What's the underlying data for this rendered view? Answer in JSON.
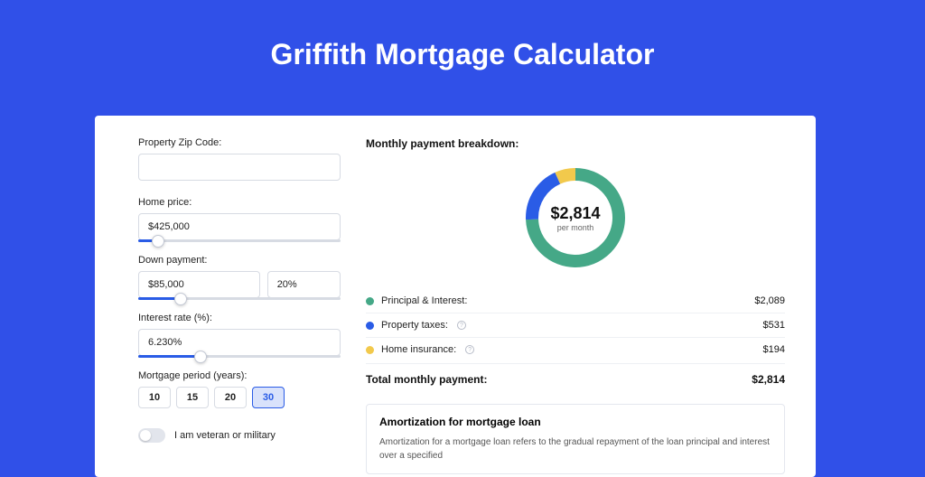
{
  "page": {
    "title": "Griffith Mortgage Calculator"
  },
  "form": {
    "zip": {
      "label": "Property Zip Code:",
      "value": ""
    },
    "home_price": {
      "label": "Home price:",
      "value": "$425,000",
      "slider_pct": 10
    },
    "down_payment": {
      "label": "Down payment:",
      "amount": "$85,000",
      "percent": "20%",
      "slider_pct": 21
    },
    "interest_rate": {
      "label": "Interest rate (%):",
      "value": "6.230%",
      "slider_pct": 31
    },
    "period": {
      "label": "Mortgage period (years):",
      "options": [
        "10",
        "15",
        "20",
        "30"
      ],
      "selected": "30"
    },
    "veteran": {
      "label": "I am veteran or military",
      "on": false
    }
  },
  "breakdown": {
    "title": "Monthly payment breakdown:",
    "center_amount": "$2,814",
    "center_sub": "per month",
    "items": [
      {
        "key": "principal_interest",
        "label": "Principal & Interest:",
        "value": "$2,089",
        "color": "#45a887",
        "info": false
      },
      {
        "key": "property_taxes",
        "label": "Property taxes:",
        "value": "$531",
        "color": "#2a5ce6",
        "info": true
      },
      {
        "key": "home_insurance",
        "label": "Home insurance:",
        "value": "$194",
        "color": "#f2c94c",
        "info": true
      }
    ],
    "total_label": "Total monthly payment:",
    "total_value": "$2,814"
  },
  "amortization": {
    "title": "Amortization for mortgage loan",
    "text": "Amortization for a mortgage loan refers to the gradual repayment of the loan principal and interest over a specified"
  },
  "chart_data": {
    "type": "pie",
    "title": "Monthly payment breakdown",
    "series": [
      {
        "name": "Principal & Interest",
        "value": 2089,
        "color": "#45a887"
      },
      {
        "name": "Property taxes",
        "value": 531,
        "color": "#2a5ce6"
      },
      {
        "name": "Home insurance",
        "value": 194,
        "color": "#f2c94c"
      }
    ],
    "total": 2814,
    "unit": "USD/month"
  }
}
